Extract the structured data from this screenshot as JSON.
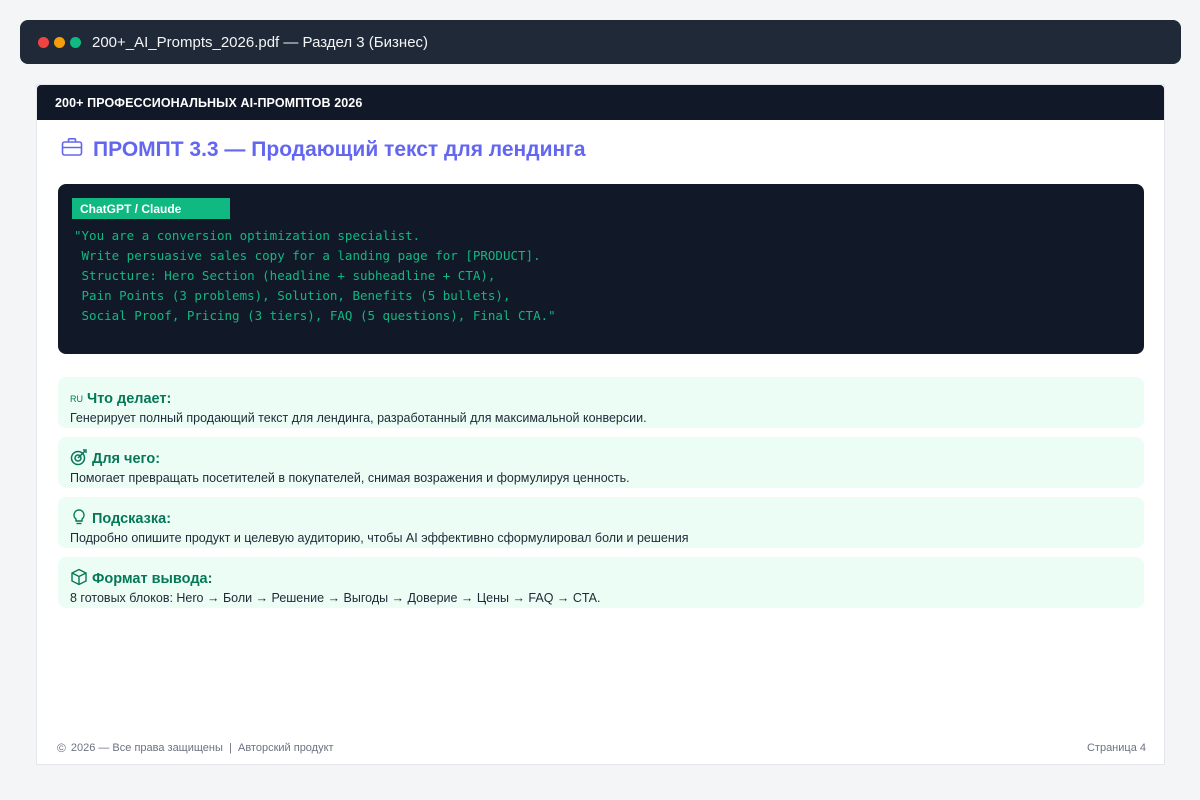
{
  "window": {
    "title": "200+_AI_Prompts_2026.pdf — Раздел 3 (Бизнес)"
  },
  "document": {
    "header": "200+ ПРОФЕССИОНАЛЬНЫХ AI-ПРОМПТОВ 2026",
    "prompt_title": "ПРОМПТ 3.3 — Продающий текст для лендинга",
    "model_tag": "ChatGPT / Claude",
    "prompt_text": "\"You are a conversion optimization specialist.\n Write persuasive sales copy for a landing page for [PRODUCT].\n Structure: Hero Section (headline + subheadline + CTA),\n Pain Points (3 problems), Solution, Benefits (5 bullets),\n Social Proof, Pricing (3 tiers), FAQ (5 questions), Final CTA.\"",
    "sections": [
      {
        "icon": "ru-flag-icon",
        "icon_text": "RU",
        "label": "Что делает:",
        "text": "Генерирует полный продающий текст для лендинга, разработанный для максимальной конверсии."
      },
      {
        "icon": "target-icon",
        "label": "Для чего:",
        "text": "Помогает превращать посетителей в покупателей, снимая возражения и формулируя ценность."
      },
      {
        "icon": "lightbulb-icon",
        "label": "Подсказка:",
        "text": "Подробно опишите продукт и целевую аудиторию, чтобы AI эффективно сформулировал боли и решения"
      },
      {
        "icon": "box-icon",
        "label": "Формат вывода:",
        "text": "8 готовых блоков: Hero → Боли → Решение → Выгоды → Доверие → Цены → FAQ → CTA."
      }
    ],
    "footer": {
      "copyright": "2026 — Все права защищены  |  Авторский продукт",
      "page": "Страница 4"
    }
  },
  "colors": {
    "accent_title": "#6366f1",
    "accent_green": "#10b981",
    "card_bg": "#ecfdf5",
    "label_green": "#047857",
    "code_bg": "#111827"
  }
}
